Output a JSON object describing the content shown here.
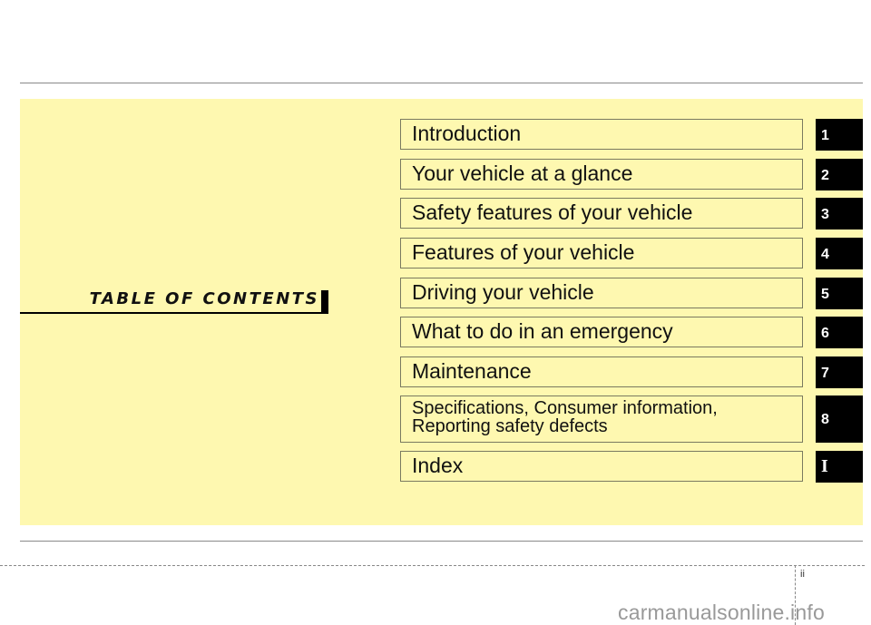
{
  "title": "TABLE OF CONTENTS",
  "page_number": "ii",
  "watermark": "carmanualsonline.info",
  "colors": {
    "panel_background": "#fef8b0",
    "tab_background": "#000000",
    "tab_text": "#ffffff"
  },
  "chapters": [
    {
      "label": "Introduction",
      "tab": "1"
    },
    {
      "label": "Your vehicle at a glance",
      "tab": "2"
    },
    {
      "label": "Safety features of your vehicle",
      "tab": "3"
    },
    {
      "label": "Features of your vehicle",
      "tab": "4"
    },
    {
      "label": "Driving your vehicle",
      "tab": "5"
    },
    {
      "label": "What to do in an emergency",
      "tab": "6"
    },
    {
      "label": "Maintenance",
      "tab": "7"
    },
    {
      "label": "Specifications, Consumer information,\nReporting safety defects",
      "tab": "8"
    },
    {
      "label": "Index",
      "tab": "I"
    }
  ]
}
